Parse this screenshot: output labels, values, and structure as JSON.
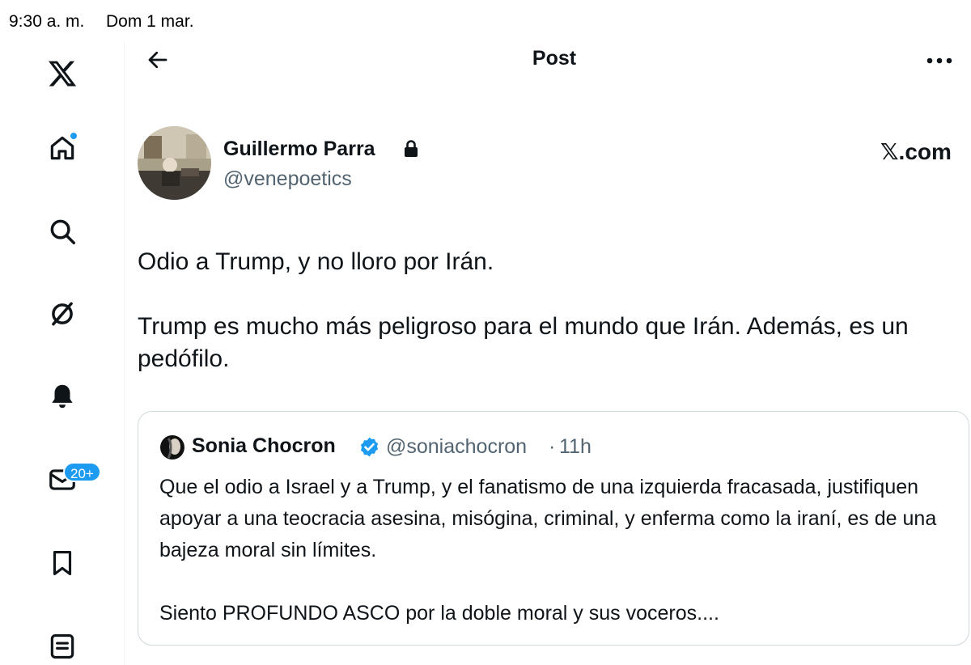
{
  "status_bar": {
    "time": "9:30 a. m.",
    "date": "Dom 1 mar."
  },
  "sidebar": {
    "items": [
      {
        "name": "x-logo-icon"
      },
      {
        "name": "home-icon",
        "has_dot": true
      },
      {
        "name": "search-icon"
      },
      {
        "name": "grok-icon"
      },
      {
        "name": "bell-icon"
      },
      {
        "name": "mail-icon",
        "badge": "20+"
      },
      {
        "name": "bookmark-icon"
      },
      {
        "name": "lists-icon"
      }
    ]
  },
  "header": {
    "title": "Post"
  },
  "post": {
    "author_name": "Guillermo Parra",
    "author_handle": "@venepoetics",
    "locked": true,
    "watermark": "𝕏.com",
    "text": "Odio a Trump, y no lloro por Irán.\n\nTrump es mucho más peligroso para el mundo que Irán. Además, es un pedófilo."
  },
  "quote": {
    "author_name": "Sonia Chocron",
    "verified": true,
    "handle": "@soniachocron",
    "separator": "·",
    "time": "11h",
    "text": "Que el odio a Israel y a Trump, y el fanatismo de una izquierda fracasada, justifiquen apoyar a una teocracia asesina, misógina, criminal, y enferma como la iraní, es de una bajeza moral sin límites.\n\nSiento PROFUNDO ASCO por la doble moral y sus voceros...."
  },
  "colors": {
    "accent": "#1d9bf0",
    "text": "#0f1419",
    "secondary": "#536471",
    "border": "#cfd9de"
  }
}
